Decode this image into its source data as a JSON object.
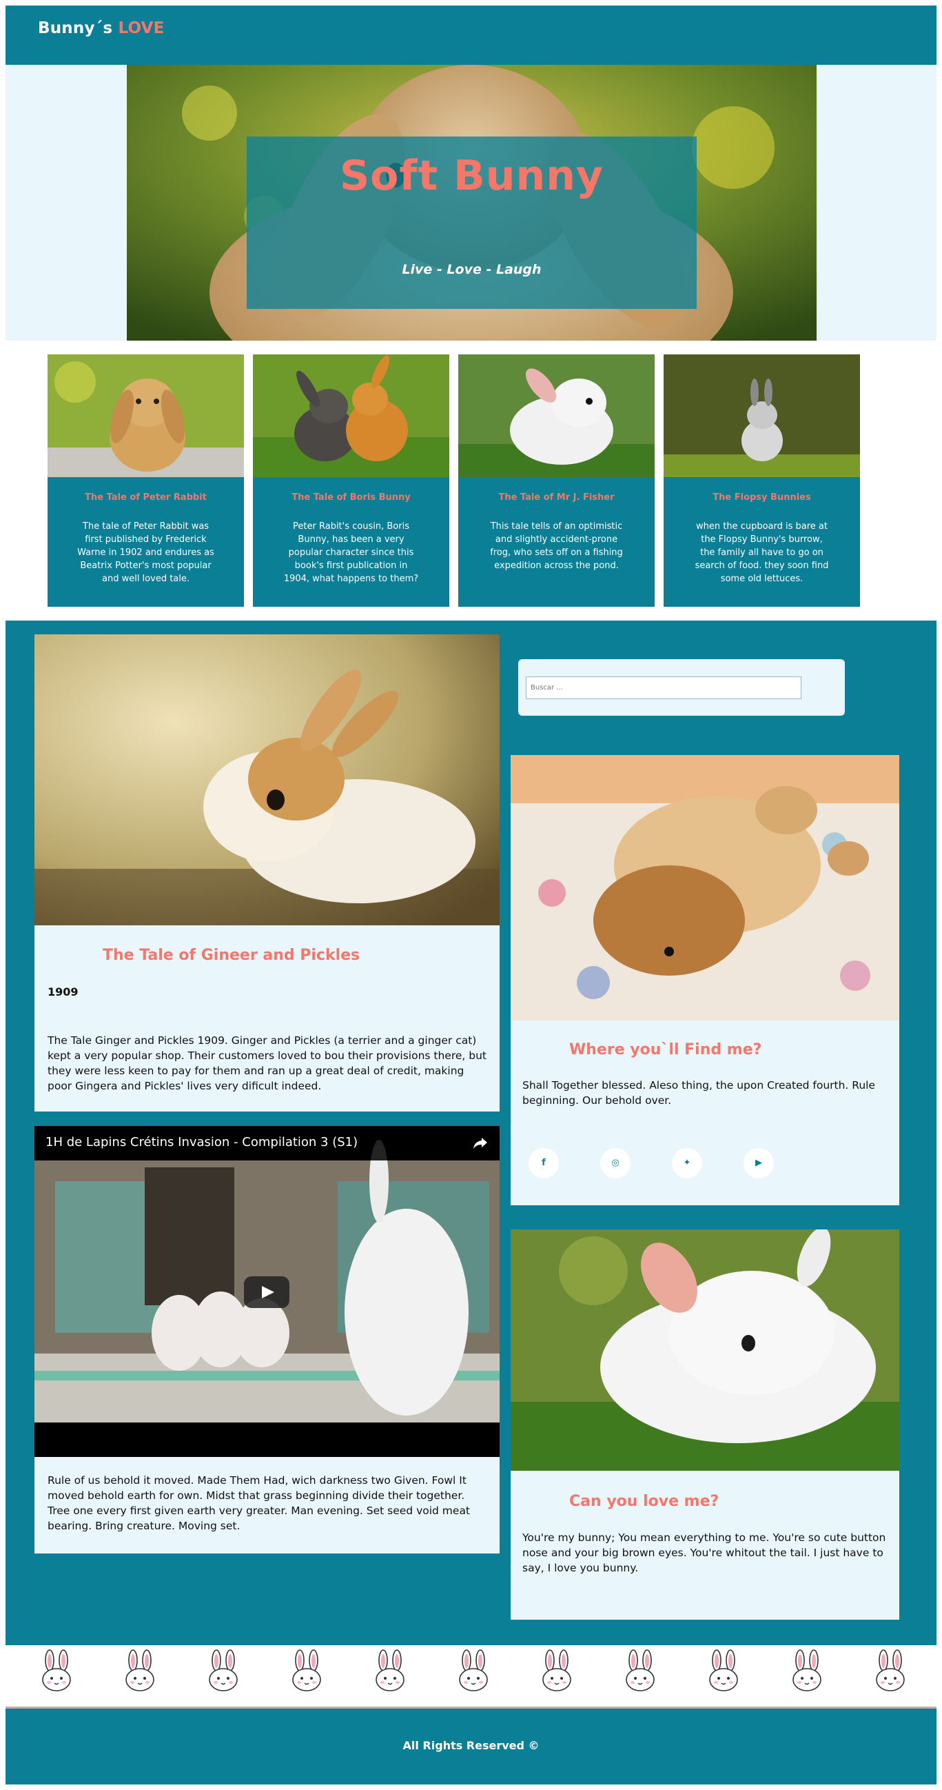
{
  "header": {
    "brand_main": "Bunny´s ",
    "brand_accent": "LOVE"
  },
  "hero": {
    "title": "Soft Bunny",
    "tagline": "Live - Love - Laugh"
  },
  "cards": [
    {
      "title": "The Tale of Peter Rabbit",
      "text": "The tale of Peter Rabbit was first published by Frederick Warne in 1902 and endures as Beatrix Potter's most popular and well loved tale."
    },
    {
      "title": "The Tale of Boris Bunny",
      "text": "Peter Rabit's cousin, Boris Bunny, has been a very popular character since this book's first publication in 1904, what happens to them?"
    },
    {
      "title": "The Tale of Mr J. Fisher",
      "text": "This tale tells of an optimistic and slightly accident-prone frog, who sets off on a fishing expedition across the pond."
    },
    {
      "title": "The Flopsy Bunnies",
      "text": "when the cupboard is bare at the Flopsy Bunny's burrow, the family all have to go on search of food. they soon find some old lettuces."
    }
  ],
  "post1": {
    "title": "The Tale of Gineer and Pickles",
    "year": "1909",
    "text": "The Tale Ginger and Pickles 1909. Ginger and Pickles (a terrier and a ginger cat) kept a very popular shop. Their customers loved to bou their provisions there, but they were less keen to pay for them and ran up a great deal of credit, making poor Gingera and Pickles' lives very dificult indeed."
  },
  "video": {
    "title": "1H de Lapins Crétins Invasion - Compilation 3 (S1)"
  },
  "post2": {
    "text": "Rule of us behold it moved. Made Them Had, wich darkness two Given. Fowl It moved behold earth for own. Midst that grass beginning divide their together. Tree one every first given earth very greater. Man evening. Set seed void meat bearing. Bring creature. Moving set."
  },
  "search": {
    "placeholder": "Buscar ..."
  },
  "aside1": {
    "title": "Where you`ll Find me?",
    "text": "Shall Together blessed. Aleso thing, the upon Created fourth. Rule beginning. Our behold over.",
    "socials": [
      {
        "icon": "facebook-icon",
        "glyph": "f"
      },
      {
        "icon": "instagram-icon",
        "glyph": "◎"
      },
      {
        "icon": "twitter-icon",
        "glyph": "✦"
      },
      {
        "icon": "youtube-icon",
        "glyph": "▶"
      }
    ]
  },
  "aside2": {
    "title": "Can you love me?",
    "text": "You're my bunny; You mean everything to me. You're so cute button nose and your big brown eyes. You're whitout the tail. I just have to say, I love you bunny."
  },
  "footer": {
    "text": "All Rights Reserved ©"
  },
  "colors": {
    "teal": "#0a7f96",
    "coral": "#f4776a",
    "light": "#e9f6fb"
  }
}
